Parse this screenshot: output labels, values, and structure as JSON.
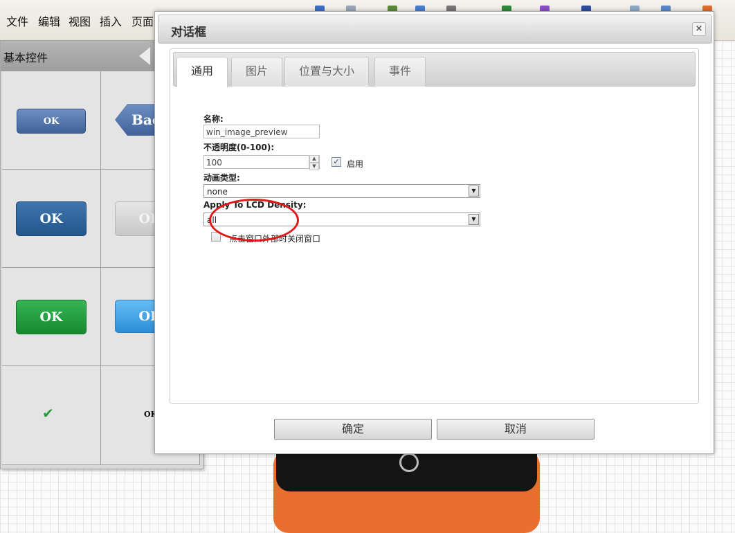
{
  "menubar": {
    "items": [
      "文件",
      "编辑",
      "视图",
      "插入",
      "页面"
    ]
  },
  "left_panel": {
    "title": "基本控件",
    "samples": [
      {
        "label": "OK",
        "color": "#4a6fa5"
      },
      {
        "label": "Bac",
        "color": "#4a6fa5"
      },
      {
        "label": "OK",
        "color": "#2f5f93"
      },
      {
        "label": "OK",
        "color": "#bdbdbd"
      },
      {
        "label": "OK",
        "color": "#1fa045"
      },
      {
        "label": "OK",
        "color": "#3aa1e8"
      },
      {
        "label": "✔",
        "color": "#2a9a3a"
      },
      {
        "label": "OK",
        "color": "#000000"
      }
    ]
  },
  "dialog": {
    "title": "对话框",
    "close_label": "×",
    "tabs": [
      "通用",
      "图片",
      "位置与大小",
      "事件"
    ],
    "active_tab": "通用",
    "form": {
      "name_label": "名称:",
      "name_value": "win_image_preview",
      "opacity_label": "不透明度(0-100):",
      "opacity_value": "100",
      "enable_label": "启用",
      "enable_checked": true,
      "animation_label": "动画类型:",
      "animation_value": "none",
      "density_label": "Apply To LCD Density:",
      "density_value": "all",
      "close_outside_label": "点击窗口外部时关闭窗口",
      "close_outside_checked": false
    },
    "buttons": {
      "ok": "确定",
      "cancel": "取消"
    }
  }
}
